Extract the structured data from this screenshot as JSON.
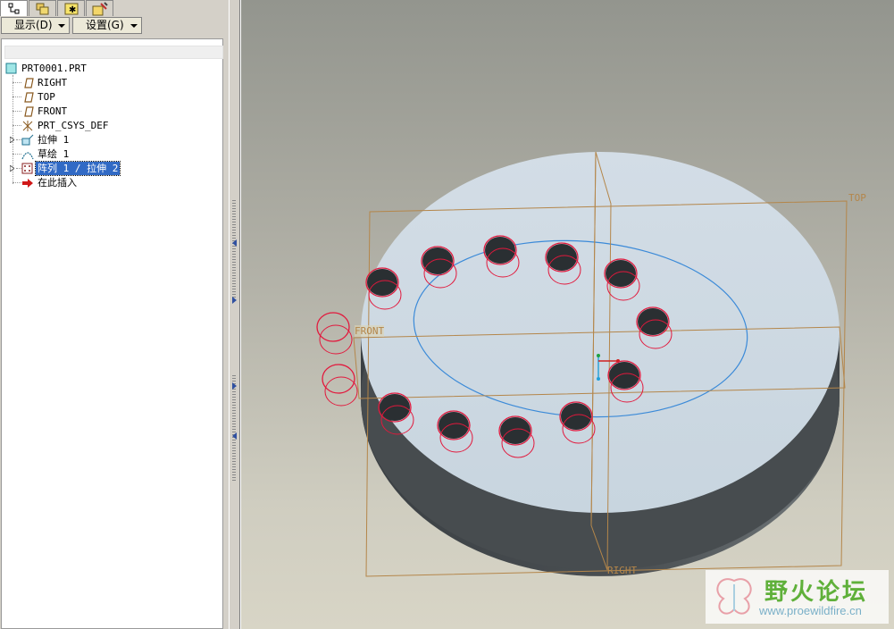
{
  "tabs": [
    {
      "name": "model-tree-icon",
      "active": true
    },
    {
      "name": "layers-icon",
      "active": false
    },
    {
      "name": "favorites-icon",
      "active": false
    },
    {
      "name": "tools-icon",
      "active": false
    }
  ],
  "menu": {
    "show_label": "显示(D)",
    "settings_label": "设置(G)"
  },
  "tree": {
    "root": "PRT0001.PRT",
    "items": [
      {
        "label": "RIGHT",
        "icon": "datum-plane-icon"
      },
      {
        "label": "TOP",
        "icon": "datum-plane-icon"
      },
      {
        "label": "FRONT",
        "icon": "datum-plane-icon"
      },
      {
        "label": "PRT_CSYS_DEF",
        "icon": "csys-icon"
      },
      {
        "label": "拉伸 1",
        "icon": "extrude-icon"
      },
      {
        "label": "草绘 1",
        "icon": "sketch-icon"
      },
      {
        "label": "阵列 1 / 拉伸 2",
        "icon": "pattern-icon"
      },
      {
        "label": "在此插入",
        "icon": "insert-arrow-icon"
      }
    ]
  },
  "viewport": {
    "datum_labels": {
      "top": "TOP",
      "front": "FRONT",
      "right": "RIGHT"
    },
    "colors": {
      "top_face": "#ccd8e2",
      "side_face": "#4a4f52",
      "hole_curve": "#e2183c",
      "sketch_curve": "#3b8ad8",
      "datum": "#b4864a"
    }
  },
  "watermark": {
    "title": "野火论坛",
    "url": "www.proewildfire.cn"
  }
}
